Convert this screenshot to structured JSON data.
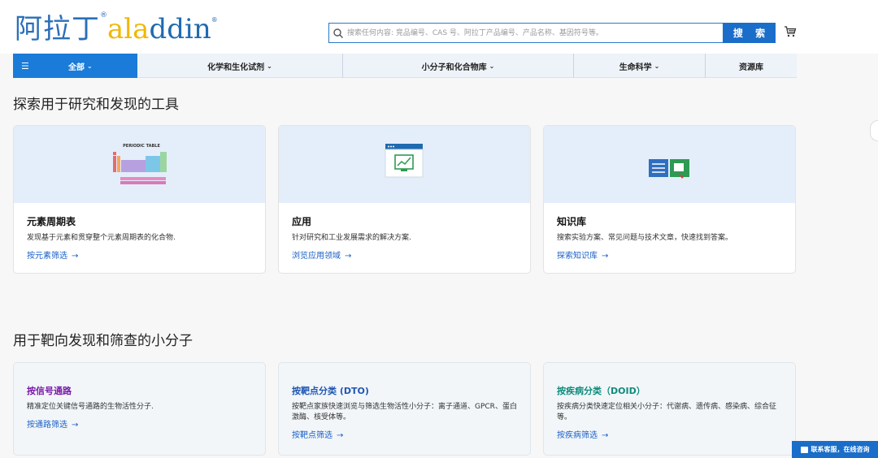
{
  "header": {
    "logo_cn": "阿拉丁",
    "logo_en_a1": "a",
    "logo_en_la": "la",
    "logo_en_ddin": "ddin",
    "logo_reg": "®",
    "search_placeholder": "搜索任何内容: 竞品编号、CAS 号、阿拉丁产品编号、产品名称、基因符号等。",
    "search_button": "搜 索",
    "icons": [
      "search-icon",
      "cart-icon"
    ]
  },
  "nav": {
    "all": "全部",
    "items": [
      "化学和生化试剂",
      "小分子和化合物库",
      "生命科学",
      "资源库"
    ],
    "caret": "⌄"
  },
  "tools_section": {
    "heading": "探索用于研究和发现的工具",
    "cards": [
      {
        "title": "元素周期表",
        "desc": "发现基于元素和贯穿整个元素周期表的化合物.",
        "link": "按元素筛选",
        "image_label": "PERIODIC TABLE"
      },
      {
        "title": "应用",
        "desc": "针对研究和工业发展需求的解决方案.",
        "link": "浏览应用领域"
      },
      {
        "title": "知识库",
        "desc": "搜索实验方案、常见问题与技术文章，快速找到答案。",
        "link": "探索知识库"
      }
    ]
  },
  "molecules_section": {
    "heading": "用于靶向发现和筛查的小分子",
    "cards": [
      {
        "title": "按信号通路",
        "desc": "精准定位关键信号通路的生物活性分子.",
        "link": "按通路筛选"
      },
      {
        "title": "按靶点分类 (DTO)",
        "desc": "按靶点家族快速浏览与筛选生物活性小分子：离子通道、GPCR、蛋白激酶、核受体等。",
        "link": "按靶点筛选"
      },
      {
        "title": "按疾病分类（DOID）",
        "desc": "按疾病分类快速定位相关小分子：代谢病、遗传病、感染病、综合征等。",
        "link": "按疾病筛选"
      }
    ]
  },
  "arrow": "→",
  "support_label": "联系客服，在线咨询",
  "colors": {
    "brand_blue": "#1a6dc9",
    "logo_yellow": "#f2b705",
    "link_blue": "#1a5fc7",
    "purple": "#7a1aa8",
    "teal": "#0e8c7c"
  }
}
